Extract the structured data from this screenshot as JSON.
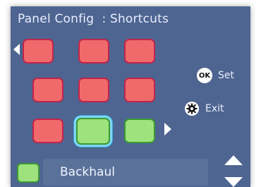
{
  "header": {
    "title": "Panel Config",
    "subtitle": ": Shortcuts"
  },
  "actions": {
    "set_label": "Set",
    "exit_label": "Exit",
    "ok_icon_text": "OK"
  },
  "status": {
    "selected_label": "Backhaul"
  },
  "grid": {
    "rows": [
      [
        "red",
        "red",
        "red"
      ],
      [
        "red",
        "red",
        "red"
      ],
      [
        "red",
        "green-selected",
        "green"
      ]
    ]
  },
  "colors": {
    "panel_bg": "#4e6591",
    "tile_red": "#f06a6b",
    "tile_green": "#9ee27e",
    "selection_glow": "#7fd6f2"
  },
  "icons": {
    "left": "triangle-left-icon",
    "right": "triangle-right-icon",
    "ok": "ok-icon",
    "gear": "gear-icon",
    "up": "arrow-up-icon",
    "down": "arrow-down-icon"
  }
}
